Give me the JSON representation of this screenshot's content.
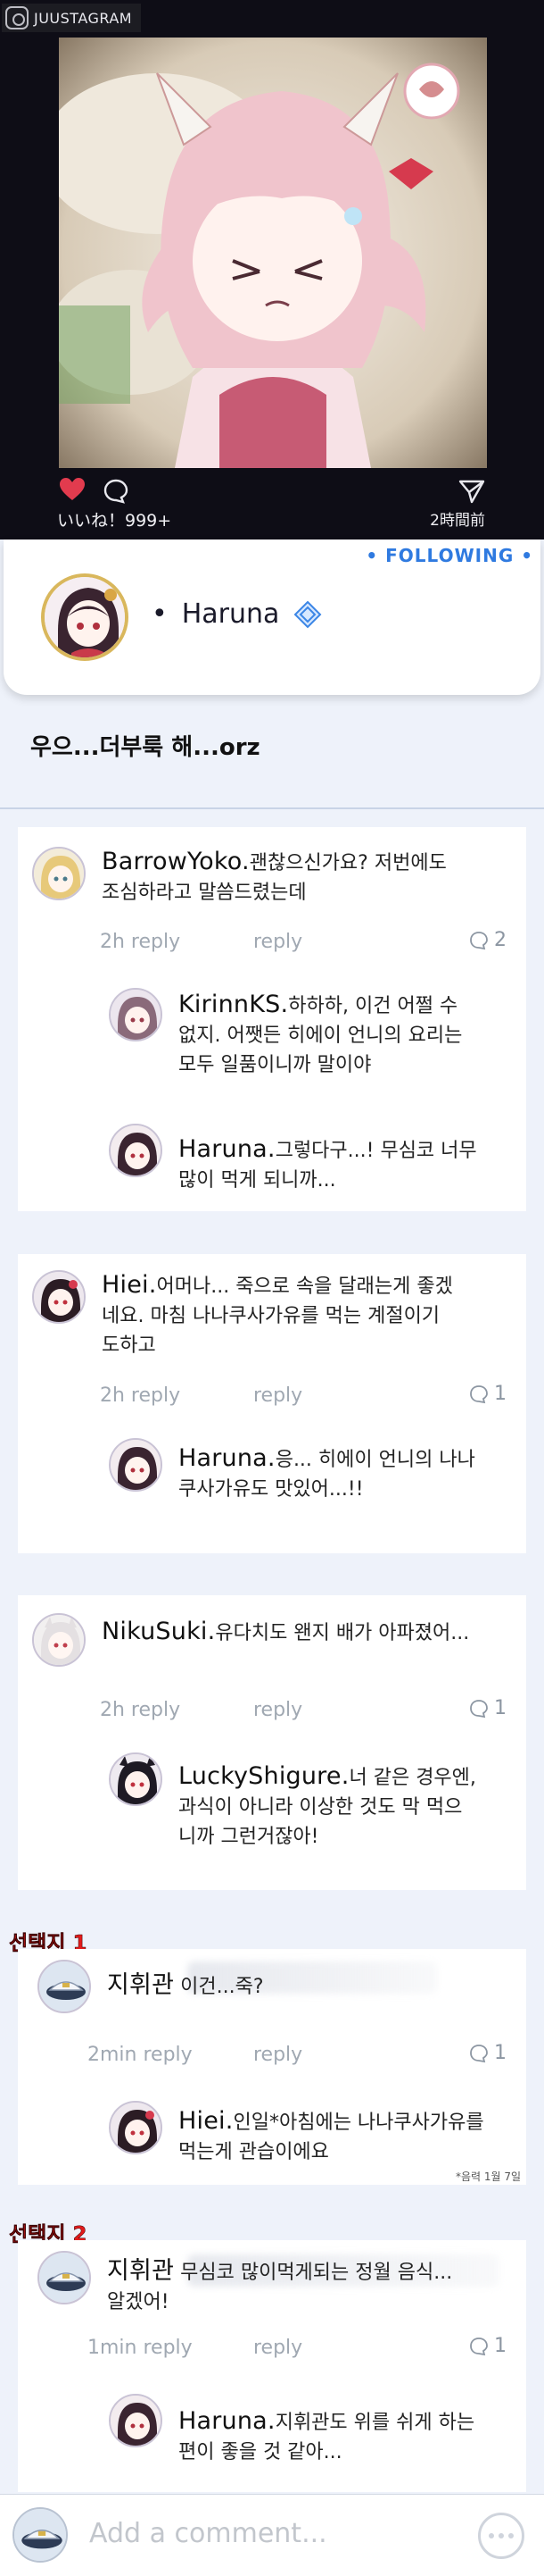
{
  "app": {
    "badge_text": "JUUSTAGRAM"
  },
  "post": {
    "likes_text": "いいね！999+",
    "time_text": "2時間前"
  },
  "profile": {
    "following_label": "FOLLOWING",
    "dot": "•",
    "name": "Haruna"
  },
  "caption": "우으...더부룩 해...orz",
  "threads": [
    {
      "comment": {
        "user": "BarrowYoko.",
        "text_lines": [
          "괜찮으신가요? 저번에도",
          "조심하라고 말씀드렸는데"
        ]
      },
      "time": "2h reply",
      "reply": "reply",
      "reply_count": "2",
      "replies": [
        {
          "user": "KirinnKS.",
          "text_lines": [
            "하하하, 이건 어쩔 수",
            "없지. 어쨋든 히에이 언니의 요리는",
            "모두 일품이니까 말이야"
          ]
        },
        {
          "user": "Haruna.",
          "text_lines": [
            "그렇다구...! 무심코 너무",
            "많이 먹게 되니까..."
          ]
        }
      ]
    },
    {
      "comment": {
        "user": "Hiei.",
        "text_lines": [
          "어머나... 죽으로 속을 달래는게 좋겠",
          "네요. 마침 나나쿠사가유를 먹는 계절이기",
          "도하고"
        ]
      },
      "time": "2h reply",
      "reply": "reply",
      "reply_count": "1",
      "replies": [
        {
          "user": "Haruna.",
          "text_lines": [
            "응... 히에이 언니의 나나",
            "쿠사가유도 맛있어...!!"
          ]
        }
      ]
    },
    {
      "comment": {
        "user": "NikuSuki.",
        "text_lines": [
          "유다치도 왠지 배가 아파졌어..."
        ]
      },
      "time": "2h reply",
      "reply": "reply",
      "reply_count": "1",
      "replies": [
        {
          "user": "LuckyShigure.",
          "text_lines": [
            "너 같은 경우엔,",
            "과식이 아니라 이상한 것도 막 먹으",
            "니까 그런거잖아!"
          ]
        }
      ]
    },
    {
      "choice_label": "선택지 1",
      "comment": {
        "user": "지휘관",
        "text_lines": [
          "이건...죽?"
        ]
      },
      "time": "2min reply",
      "reply": "reply",
      "reply_count": "1",
      "replies": [
        {
          "user": "Hiei.",
          "text_lines": [
            "인일*아침에는 나나쿠사가유를",
            "먹는게 관습이에요"
          ]
        }
      ],
      "footnote": "*음력 1월 7일"
    },
    {
      "choice_label": "선택지 2",
      "comment": {
        "user": "지휘관",
        "text_lines": [
          "무심코 많이먹게되는 정월 음식...",
          "알겠어!"
        ]
      },
      "time": "1min reply",
      "reply": "reply",
      "reply_count": "1",
      "replies": [
        {
          "user": "Haruna.",
          "text_lines": [
            "지휘관도 위를 쉬게 하는",
            "편이 좋을 것 같아..."
          ]
        }
      ]
    }
  ],
  "comment_bar": {
    "placeholder": "Add a comment..."
  },
  "colors": {
    "accent": "#2f7ae0",
    "heart": "#e23b4e",
    "choice": "#e11b1b"
  },
  "icons": [
    "heart-icon",
    "comment-bubble-icon",
    "send-icon",
    "verified-icon",
    "reply-bubble-icon",
    "more-options-icon"
  ]
}
